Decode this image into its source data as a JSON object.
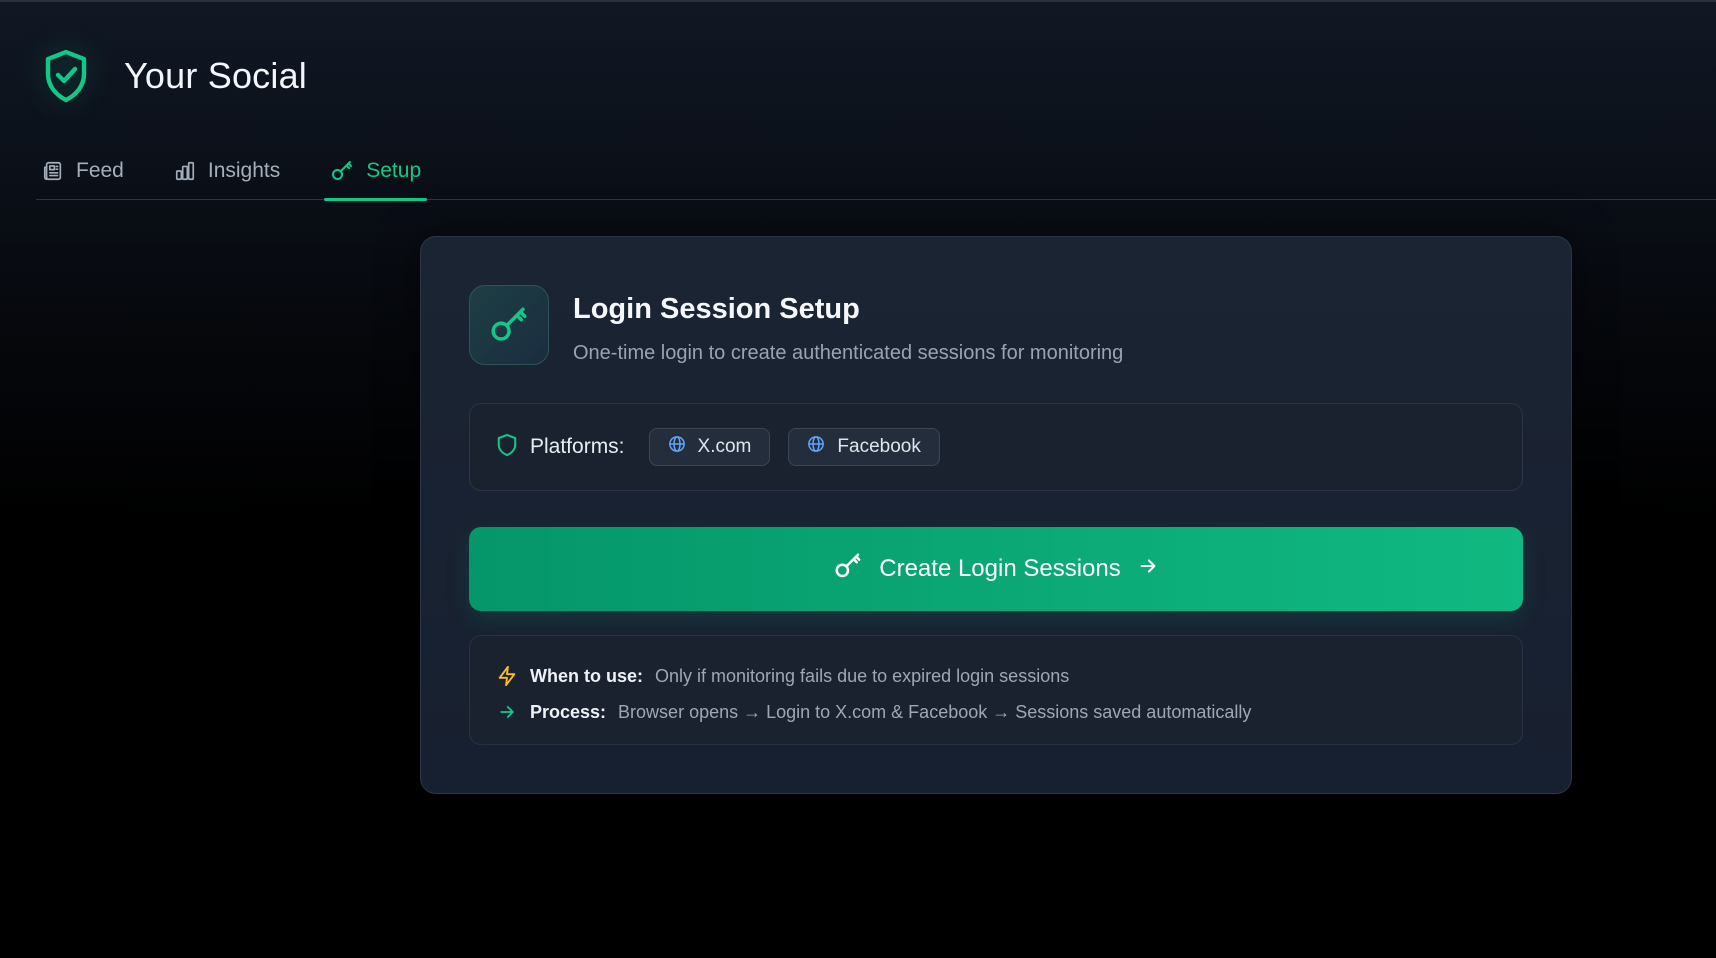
{
  "app": {
    "title": "Your Social"
  },
  "tabs": [
    {
      "label": "Feed",
      "icon": "newspaper-icon",
      "active": false
    },
    {
      "label": "Insights",
      "icon": "bar-chart-icon",
      "active": false
    },
    {
      "label": "Setup",
      "icon": "key-icon",
      "active": true
    }
  ],
  "card": {
    "title": "Login Session Setup",
    "subtitle": "One-time login to create authenticated sessions for monitoring",
    "platforms_label": "Platforms:",
    "platforms": [
      {
        "label": "X.com",
        "icon": "globe-icon"
      },
      {
        "label": "Facebook",
        "icon": "globe-icon"
      }
    ],
    "cta_label": "Create Login Sessions",
    "info": {
      "when_key": "When to use:",
      "when_value": "Only if monitoring fails due to expired login sessions",
      "process_key": "Process:",
      "process_value": "Browser opens → Login to X.com & Facebook → Sessions saved automatically"
    }
  },
  "colors": {
    "accent": "#10c987",
    "globe": "#60a5fa",
    "lightning": "#fbbf24"
  }
}
